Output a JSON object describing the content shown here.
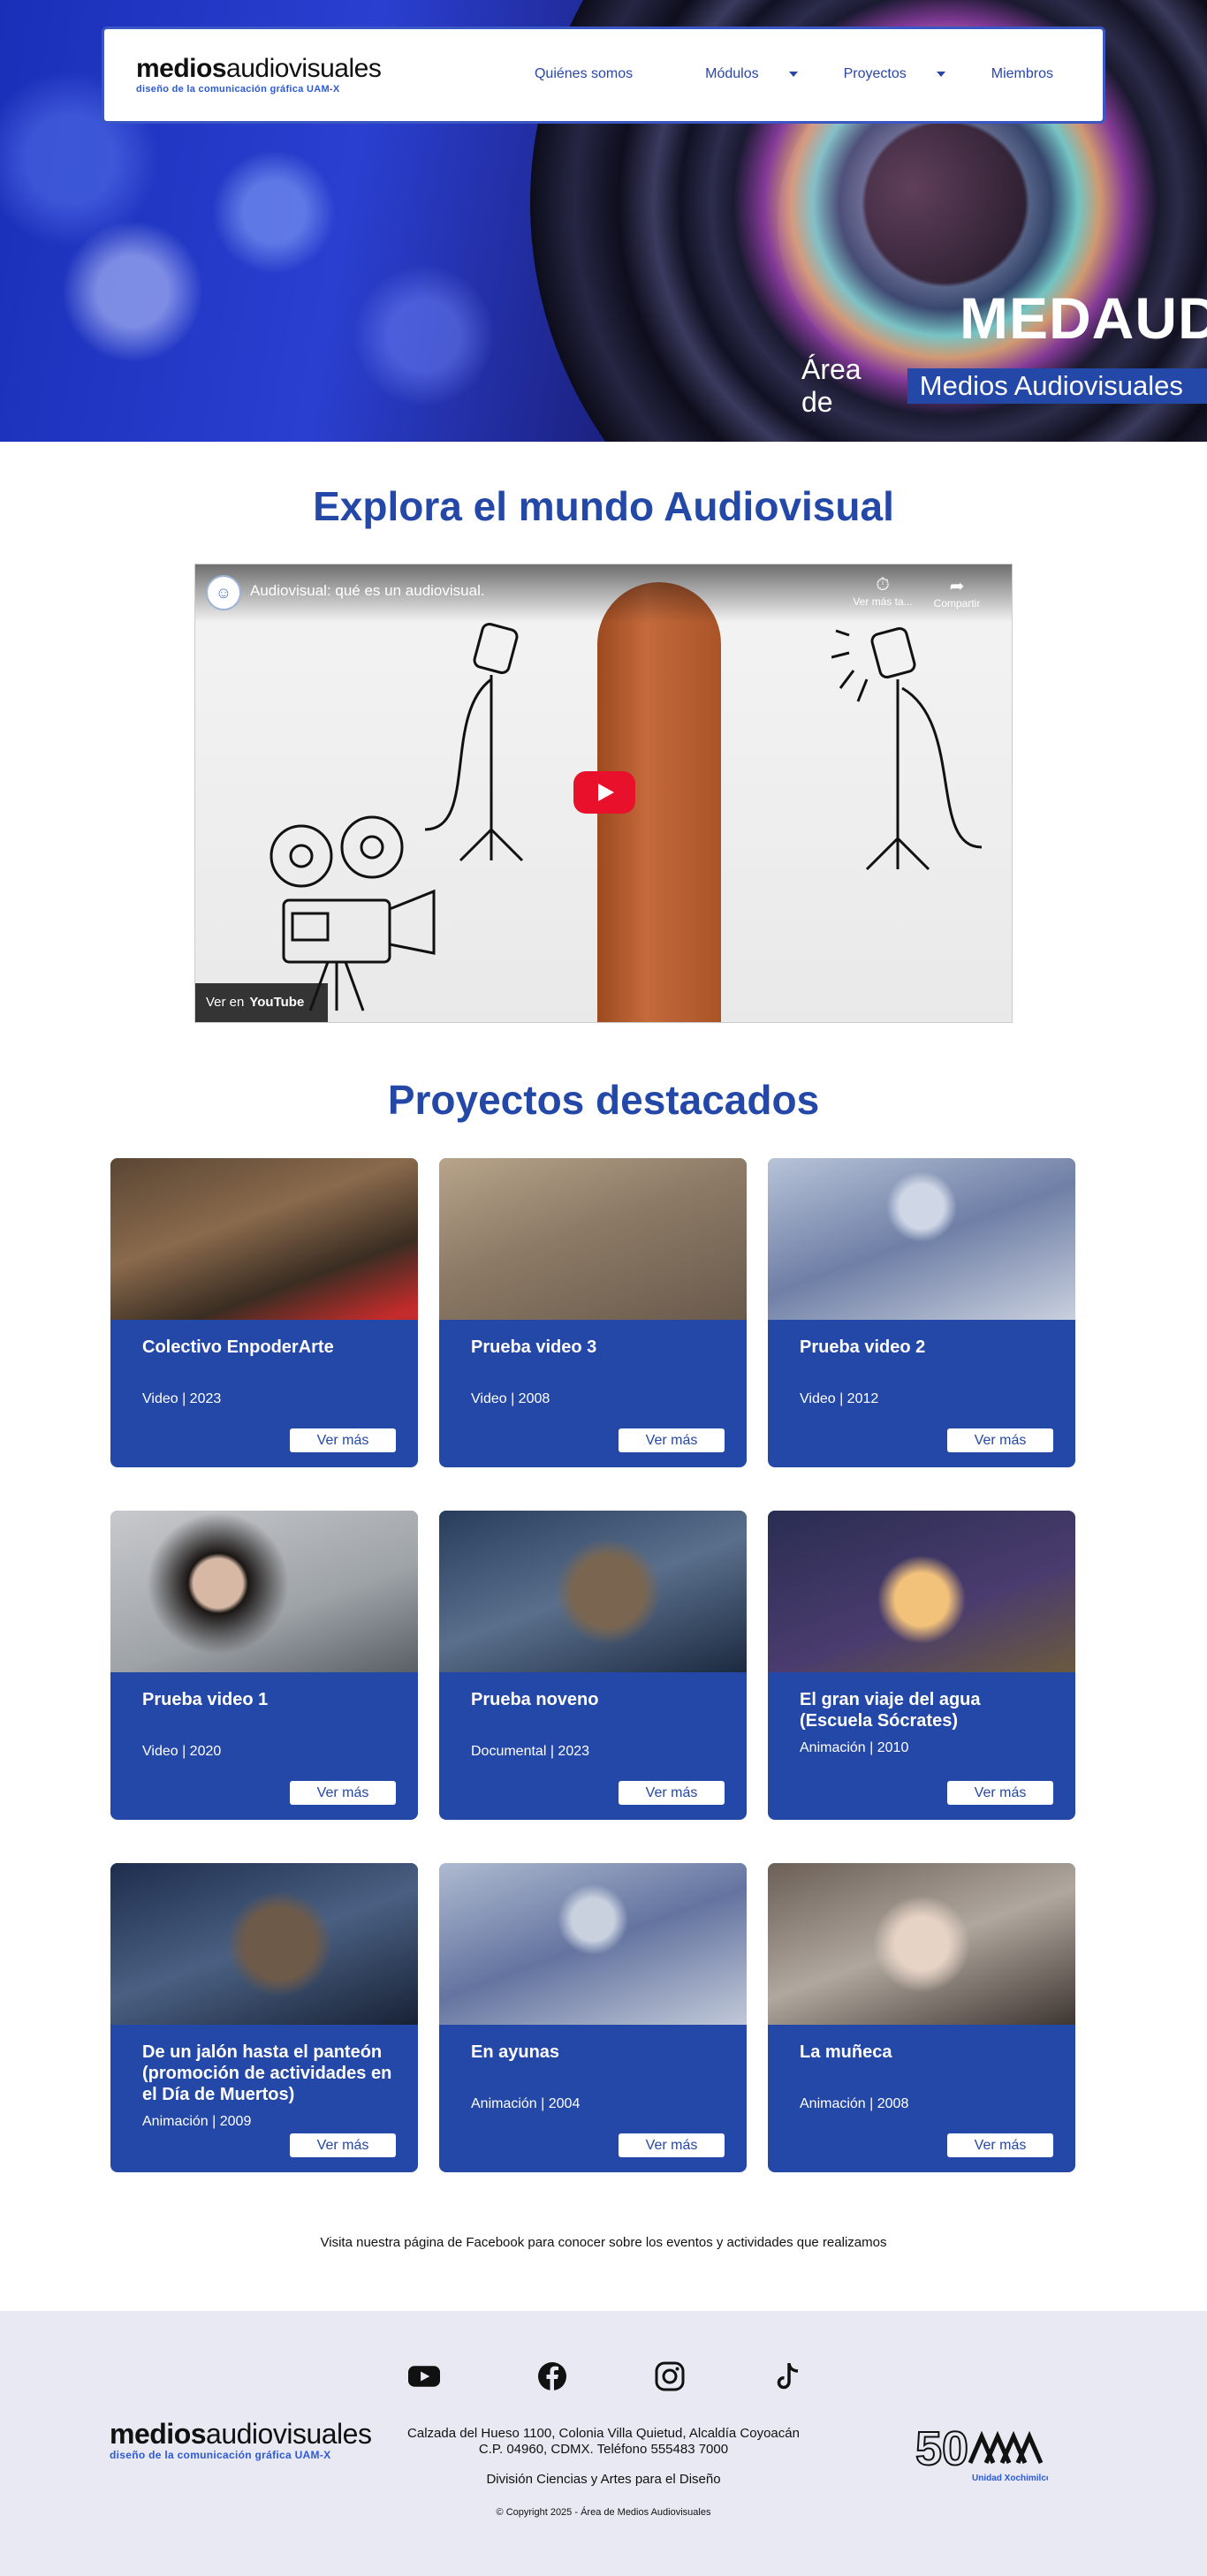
{
  "header": {
    "logo_main_bold": "medios",
    "logo_main_rest": "audiovisuales",
    "logo_sub": "diseño de la comunicación gráfica  UAM-X",
    "nav": [
      {
        "label": "Quiénes somos"
      },
      {
        "label": "Módulos"
      },
      {
        "label": "Proyectos"
      },
      {
        "label": "Miembros"
      }
    ]
  },
  "hero": {
    "title": "MEDAUD",
    "subtitle_pre": "Área de",
    "subtitle_tag": "Medios Audiovisuales"
  },
  "explore": {
    "title": "Explora el mundo Audiovisual",
    "video_title": "Audiovisual: qué es un audiovisual.",
    "watch_later": "Ver más ta...",
    "share": "Compartir",
    "watch_on": "Ver en",
    "youtube": "YouTube"
  },
  "projects": {
    "title": "Proyectos destacados",
    "button_label": "Ver más",
    "items": [
      {
        "title": "Colectivo EnpoderArte",
        "meta": "Video | 2023"
      },
      {
        "title": "Prueba video 3",
        "meta": "Video | 2008"
      },
      {
        "title": "Prueba video 2",
        "meta": "Video | 2012"
      },
      {
        "title": "Prueba video 1",
        "meta": "Video | 2020"
      },
      {
        "title": "Prueba noveno",
        "meta": "Documental | 2023"
      },
      {
        "title": "El gran viaje del agua (Escuela Sócrates)",
        "meta": "Animación | 2010"
      },
      {
        "title": "De un jalón hasta el panteón (promoción de actividades en el Día de Muertos)",
        "meta": "Animación | 2009"
      },
      {
        "title": "En ayunas",
        "meta": "Animación | 2004"
      },
      {
        "title": "La muñeca",
        "meta": "Animación | 2008"
      }
    ]
  },
  "facebook_note": "Visita nuestra página de Facebook para conocer sobre los eventos y actividades que realizamos",
  "footer": {
    "address_line1": "Calzada del Hueso 1100, Colonia Villa Quietud, Alcaldía Coyoacán",
    "address_line2": "C.P. 04960, CDMX. Teléfono 555483 7000",
    "division": "División Ciencias y Artes para el Diseño",
    "copyright": "© Copyright 2025 - Área de Medios Audiovisuales",
    "uam_50": "50",
    "uam_label": "Unidad Xochimilco",
    "social": [
      "youtube-icon",
      "facebook-icon",
      "instagram-icon",
      "tiktok-icon"
    ]
  },
  "colors": {
    "brand_blue": "#2448a8",
    "nav_border": "#3a57c4",
    "footer_bg": "#e8e9f2",
    "yt_red": "#e8102b"
  }
}
